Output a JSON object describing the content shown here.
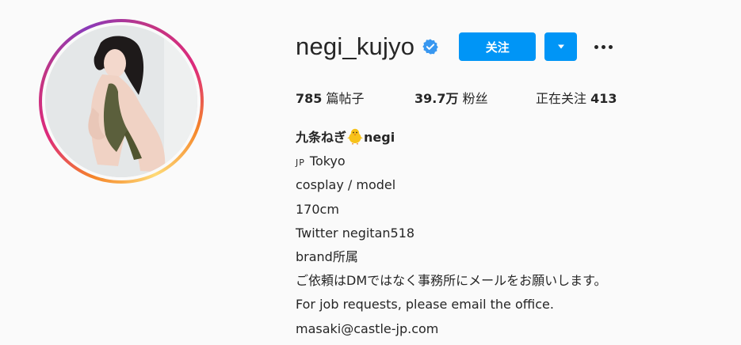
{
  "profile": {
    "username": "negi_kujyo",
    "verified_icon": "verified-badge-icon",
    "follow_label": "关注",
    "dropdown_icon": "chevron-down-icon",
    "more_icon": "more-options-icon"
  },
  "stats": {
    "posts_count": "785",
    "posts_label": "篇帖子",
    "followers_count": "39.7万",
    "followers_label": "粉丝",
    "following_label": "正在关注",
    "following_count": "413"
  },
  "bio": {
    "name_prefix": "九条ねぎ",
    "name_emoji": "chick-emoji",
    "name_suffix": "negi",
    "flag": "JP",
    "location": "Tokyo",
    "lines": [
      "cosplay / model",
      "170cm",
      "Twitter negitan518",
      "brand所属",
      "ご依頼はDMではなく事務所にメールをお願いします。",
      "For job requests, please email the office.",
      "masaki@castle-jp.com"
    ]
  },
  "colors": {
    "accent": "#0095f6",
    "verified": "#3897f0",
    "text": "#262626",
    "background": "#fafafa"
  }
}
